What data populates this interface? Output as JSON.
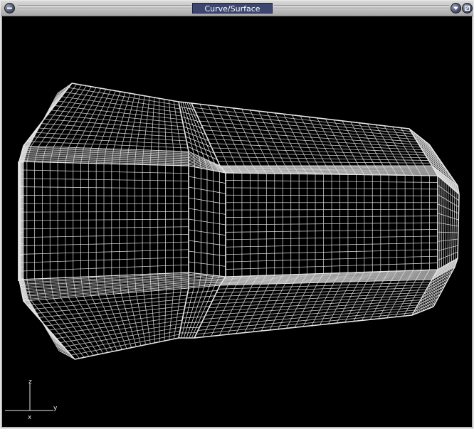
{
  "window": {
    "title": "Curve/Surface"
  },
  "viewport": {
    "background": "#000000",
    "wire_color": "#e6e6e6",
    "axes": {
      "z_label": "z",
      "y_label": "y",
      "x_label": "x"
    }
  },
  "icons": {
    "menu": "minus-icon",
    "shade": "chevron-down-icon",
    "max": "restore-icon"
  }
}
